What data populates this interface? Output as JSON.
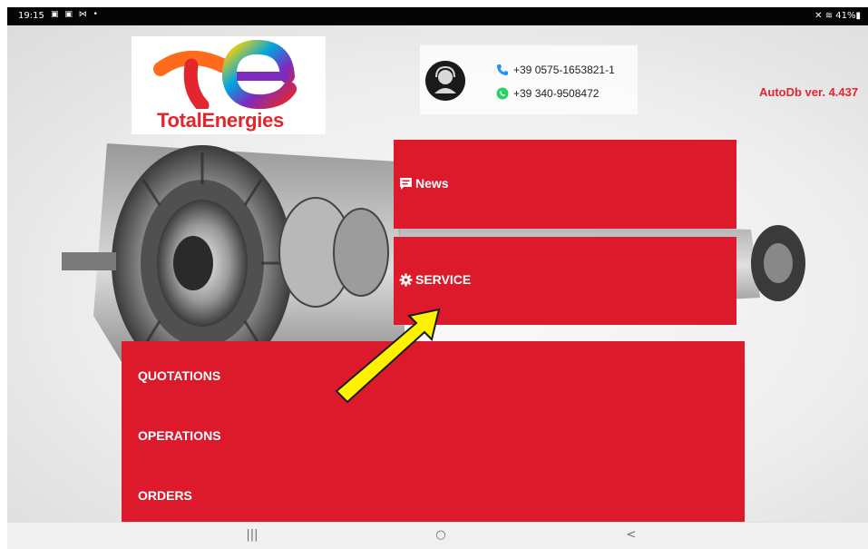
{
  "status_bar": {
    "time": "19:15",
    "left_icons": "▣ ▣ ⋈ •",
    "right": "✕ ≋ 41%▮"
  },
  "logo": {
    "text": "TotalEnergies"
  },
  "contact": {
    "support_icon": "support-agent-icon",
    "phone": "+39 0575-1653821-1",
    "whatsapp": "+39 340-9508472"
  },
  "version": "AutoDb ver. 4.437",
  "tiles": {
    "news": {
      "label": "News",
      "icon": "chat-icon"
    },
    "service": {
      "label": "SERVICE",
      "icon": "gear-icon"
    }
  },
  "menu": {
    "items": [
      {
        "label": "QUOTATIONS"
      },
      {
        "label": "OPERATIONS"
      },
      {
        "label": "ORDERS"
      }
    ]
  },
  "nav_bar": {
    "recent": "|||",
    "home": "○",
    "back": "<"
  },
  "colors": {
    "accent_red": "#dc1a2b",
    "brand_red": "#e3262e",
    "arrow_yellow": "#fff200"
  }
}
